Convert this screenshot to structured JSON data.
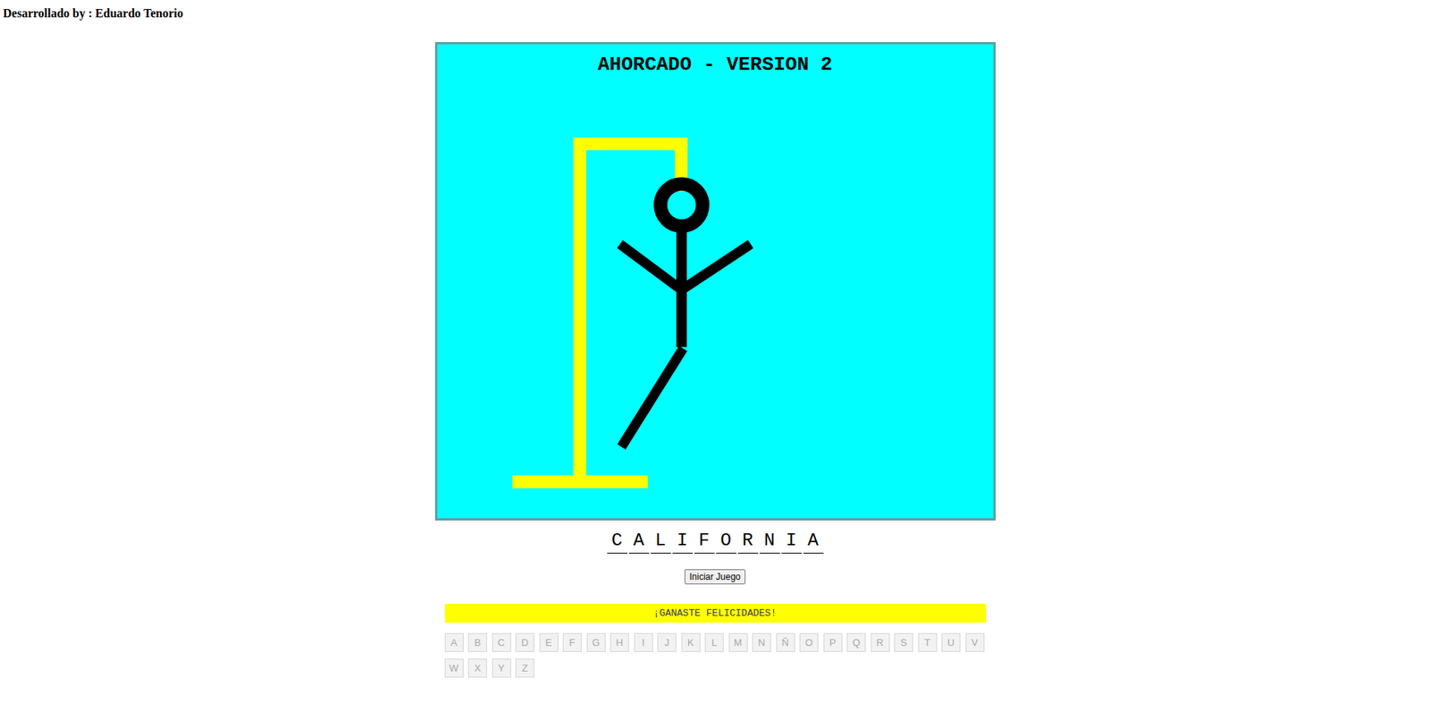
{
  "header": {
    "credit": "Desarrollado by : Eduardo Tenorio"
  },
  "game": {
    "title": "AHORCADO - VERSION 2",
    "parts": [
      {
        "kind": "head",
        "drawn": true
      },
      {
        "kind": "body",
        "drawn": true
      },
      {
        "kind": "left-arm",
        "drawn": true
      },
      {
        "kind": "right-arm",
        "drawn": true
      },
      {
        "kind": "left-leg",
        "drawn": true
      },
      {
        "kind": "right-leg",
        "drawn": false
      }
    ]
  },
  "word": [
    {
      "letter": "C",
      "revealed": true
    },
    {
      "letter": "A",
      "revealed": true
    },
    {
      "letter": "L",
      "revealed": true
    },
    {
      "letter": "I",
      "revealed": true
    },
    {
      "letter": "F",
      "revealed": true
    },
    {
      "letter": "O",
      "revealed": true
    },
    {
      "letter": "R",
      "revealed": true
    },
    {
      "letter": "N",
      "revealed": true
    },
    {
      "letter": "I",
      "revealed": true
    },
    {
      "letter": "A",
      "revealed": true
    }
  ],
  "start_button": "Iniciar Juego",
  "message": "¡GANASTE FELICIDADES!",
  "keyboard": [
    {
      "label": "A",
      "disabled": true
    },
    {
      "label": "B",
      "disabled": true
    },
    {
      "label": "C",
      "disabled": true
    },
    {
      "label": "D",
      "disabled": true
    },
    {
      "label": "E",
      "disabled": true
    },
    {
      "label": "F",
      "disabled": true
    },
    {
      "label": "G",
      "disabled": true
    },
    {
      "label": "H",
      "disabled": true
    },
    {
      "label": "I",
      "disabled": true
    },
    {
      "label": "J",
      "disabled": true
    },
    {
      "label": "K",
      "disabled": true
    },
    {
      "label": "L",
      "disabled": true
    },
    {
      "label": "M",
      "disabled": true
    },
    {
      "label": "N",
      "disabled": true
    },
    {
      "label": "Ñ",
      "disabled": true
    },
    {
      "label": "O",
      "disabled": true
    },
    {
      "label": "P",
      "disabled": true
    },
    {
      "label": "Q",
      "disabled": true
    },
    {
      "label": "R",
      "disabled": true
    },
    {
      "label": "S",
      "disabled": true
    },
    {
      "label": "T",
      "disabled": true
    },
    {
      "label": "U",
      "disabled": true
    },
    {
      "label": "V",
      "disabled": true
    },
    {
      "label": "W",
      "disabled": true
    },
    {
      "label": "X",
      "disabled": true
    },
    {
      "label": "Y",
      "disabled": true
    },
    {
      "label": "Z",
      "disabled": true
    }
  ]
}
